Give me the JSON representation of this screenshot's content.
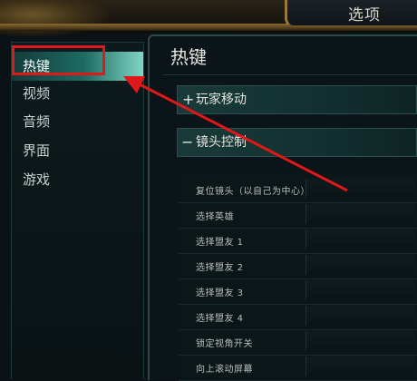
{
  "window": {
    "title": "选项"
  },
  "nav": {
    "items": [
      {
        "label": "热键",
        "active": true
      },
      {
        "label": "视频",
        "active": false
      },
      {
        "label": "音频",
        "active": false
      },
      {
        "label": "界面",
        "active": false
      },
      {
        "label": "游戏",
        "active": false
      }
    ]
  },
  "panel": {
    "title": "热键",
    "sections": [
      {
        "sign": "+",
        "label": "玩家移动",
        "expanded": false
      },
      {
        "sign": "−",
        "label": "镜头控制",
        "expanded": true
      }
    ],
    "rows": [
      "复位镜头（以自己为中心）",
      "选择英雄",
      "选择盟友 1",
      "选择盟友 2",
      "选择盟友 3",
      "选择盟友 4",
      "锁定视角开关",
      "向上滚动屏幕"
    ]
  },
  "annotation": {
    "color": "#e01818"
  }
}
